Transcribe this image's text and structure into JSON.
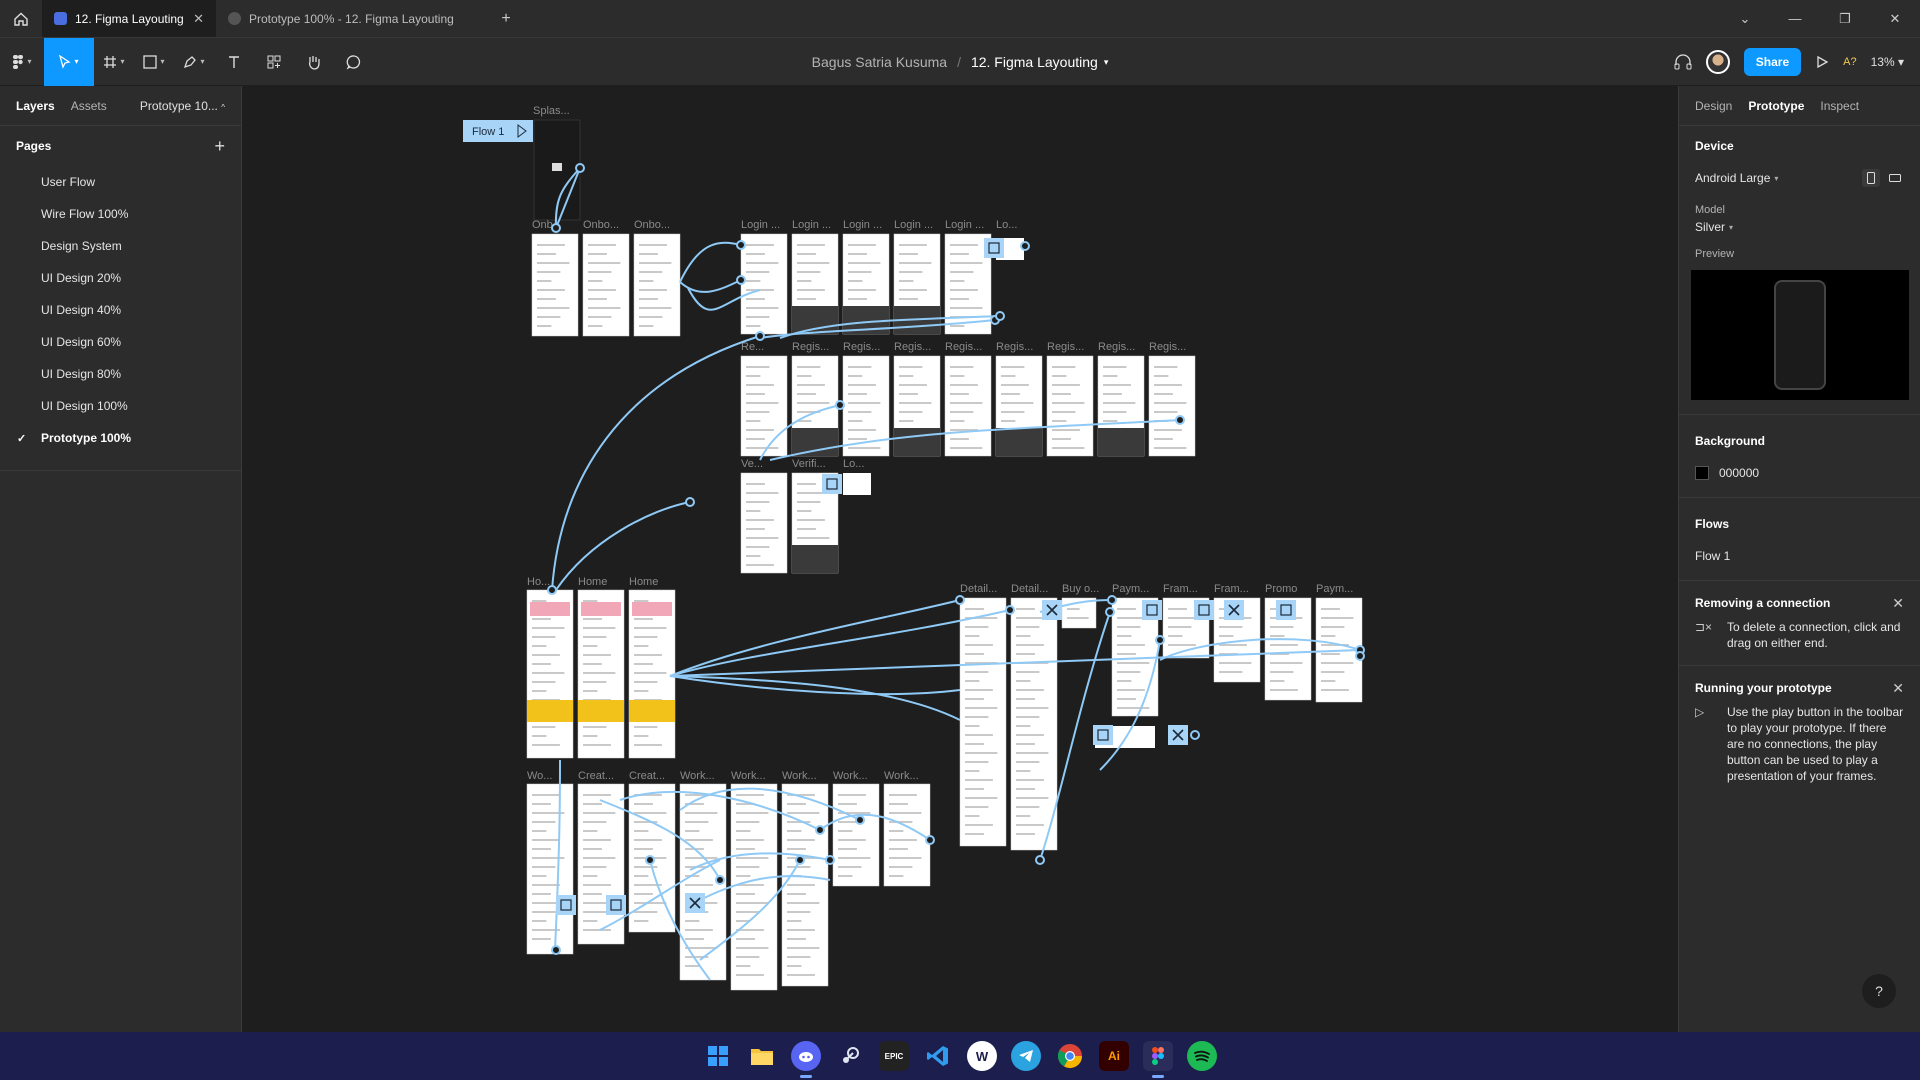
{
  "tabs": {
    "active_label": "12. Figma Layouting",
    "inactive_label": "Prototype 100% - 12. Figma Layouting",
    "close": "✕",
    "add": "+"
  },
  "window_controls": {
    "dropdown": "⌄",
    "minimize": "—",
    "restore": "❐",
    "close": "✕"
  },
  "header": {
    "project": "Bagus Satria Kusuma",
    "separator": "/",
    "file": "12. Figma Layouting",
    "share_label": "Share",
    "ai_label": "A?",
    "zoom": "13%"
  },
  "left_panel": {
    "tabs": [
      "Layers",
      "Assets"
    ],
    "page_selector": "Prototype 10...",
    "pages_title": "Pages",
    "add": "+",
    "pages": [
      {
        "label": "User Flow"
      },
      {
        "label": "Wire Flow 100%"
      },
      {
        "label": "Design System"
      },
      {
        "label": "UI Design 20%"
      },
      {
        "label": "UI Design 40%"
      },
      {
        "label": "UI Design 60%"
      },
      {
        "label": "UI Design 80%"
      },
      {
        "label": "UI Design 100%"
      },
      {
        "label": "Prototype 100%",
        "current": true
      }
    ],
    "check": "✓"
  },
  "canvas": {
    "flow_label": "Flow 1",
    "frame_labels": {
      "splash": "Splas...",
      "onboarding": [
        "Onb...",
        "Onbo...",
        "Onbo..."
      ],
      "login": [
        "Login ...",
        "Login ...",
        "Login ...",
        "Login ...",
        "Login ...",
        "Lo..."
      ],
      "register": [
        "Re...",
        "Regis...",
        "Regis...",
        "Regis...",
        "Regis...",
        "Regis...",
        "Regis...",
        "Regis...",
        "Regis..."
      ],
      "verify": [
        "Ve...",
        "Verifi...",
        "Lo..."
      ],
      "home": [
        "Ho...",
        "Home",
        "Home"
      ],
      "detail": [
        "Detail...",
        "Detail...",
        "Buy o...",
        "Paym...",
        "Fram...",
        "Fram...",
        "Promo",
        "Paym..."
      ],
      "work": [
        "Wo...",
        "Creat...",
        "Creat...",
        "Work...",
        "Work...",
        "Work...",
        "Work...",
        "Work..."
      ]
    }
  },
  "right_panel": {
    "tabs": [
      "Design",
      "Prototype",
      "Inspect"
    ],
    "device_title": "Device",
    "device_value": "Android Large",
    "model_label": "Model",
    "model_value": "Silver",
    "preview_label": "Preview",
    "background_title": "Background",
    "background_hex": "000000",
    "flows_title": "Flows",
    "flows": [
      "Flow 1"
    ],
    "removing_title": "Removing a connection",
    "removing_text": "To delete a connection, click and drag on either end.",
    "running_title": "Running your prototype",
    "running_text": "Use the play button in the toolbar to play your prototype. If there are no connections, the play button can be used to play a presentation of your frames.",
    "help": "?"
  },
  "taskbar": {
    "icons": [
      "windows-start",
      "file-explorer",
      "discord",
      "steam",
      "epic-games",
      "vscode",
      "browser-w",
      "telegram",
      "chrome",
      "illustrator",
      "figma",
      "spotify"
    ],
    "ai_text": "Ai",
    "epic_text": "EPIC"
  },
  "colors": {
    "accent": "#0d99ff",
    "connector": "#8fc9f5",
    "taskbar": "#1c1f4d"
  }
}
